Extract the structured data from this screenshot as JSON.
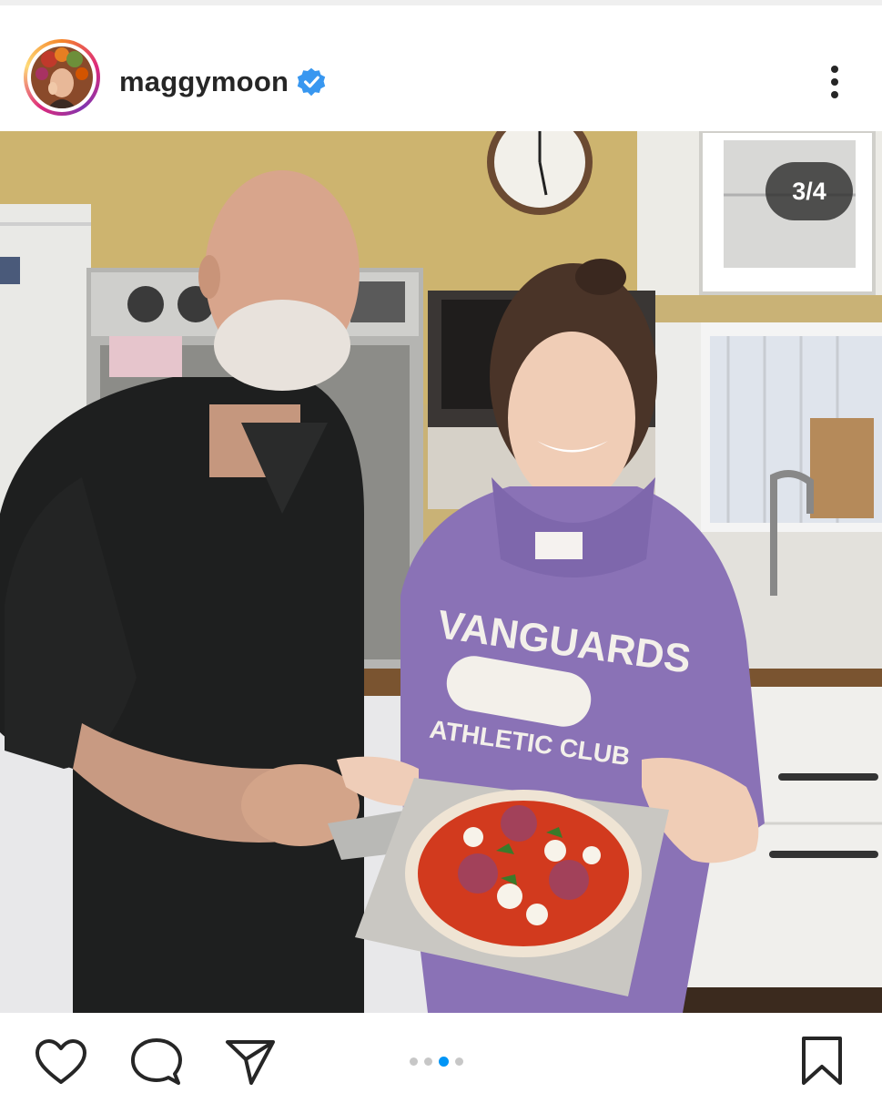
{
  "post": {
    "username": "maggymoon",
    "verified": true,
    "image_counter": "3/4",
    "carousel": {
      "total": 4,
      "active_index": 2
    },
    "photo_text": {
      "hoodie_line1": "VANGUARDS",
      "hoodie_line2": "ATHLETIC CLUB"
    }
  },
  "icons": {
    "verified": "verified-badge-icon",
    "more": "more-options-icon",
    "like": "heart-icon",
    "comment": "comment-icon",
    "share": "paper-plane-icon",
    "save": "bookmark-icon"
  },
  "colors": {
    "verified": "#3897f0",
    "active_dot": "#0095f6",
    "inactive_dot": "#c7c7c7",
    "text": "#262626"
  }
}
